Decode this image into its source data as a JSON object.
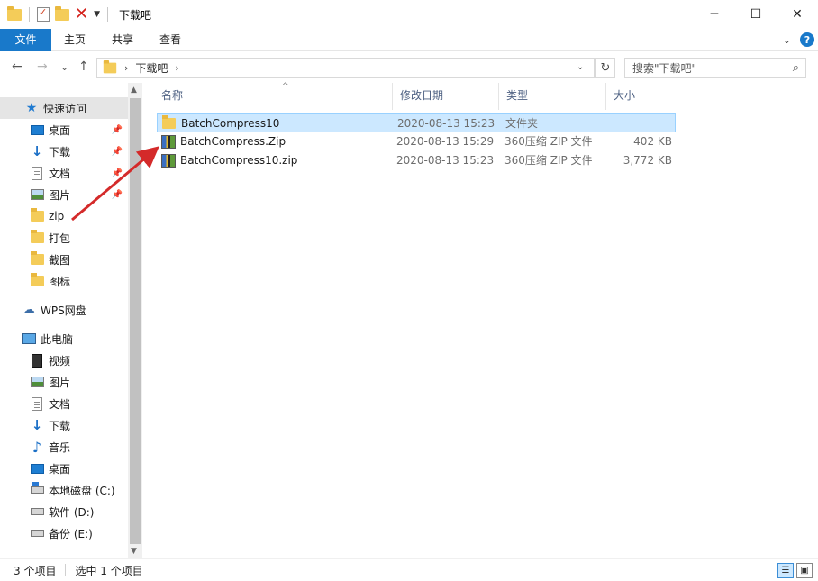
{
  "window": {
    "title": "下载吧",
    "minimize_label": "─",
    "maximize_label": "☐",
    "close_label": "✕"
  },
  "ribbon": {
    "tabs": [
      "文件",
      "主页",
      "共享",
      "查看"
    ]
  },
  "nav": {
    "back": "←",
    "forward": "→",
    "recent": "⌄",
    "up": "↑",
    "breadcrumb": [
      "下载吧"
    ],
    "refresh": "↻",
    "search_placeholder": "搜索\"下载吧\""
  },
  "sidebar": {
    "quick_access": {
      "label": "快速访问",
      "icon": "star-icon",
      "items": [
        {
          "label": "桌面",
          "icon": "desktop-icon",
          "pinned": true
        },
        {
          "label": "下载",
          "icon": "download-icon",
          "pinned": true
        },
        {
          "label": "文档",
          "icon": "document-icon",
          "pinned": true
        },
        {
          "label": "图片",
          "icon": "picture-icon",
          "pinned": true
        },
        {
          "label": "zip",
          "icon": "folder-icon",
          "pinned": false
        },
        {
          "label": "打包",
          "icon": "folder-icon",
          "pinned": false
        },
        {
          "label": "截图",
          "icon": "folder-icon",
          "pinned": false
        },
        {
          "label": "图标",
          "icon": "folder-icon",
          "pinned": false
        }
      ]
    },
    "wps": {
      "label": "WPS网盘",
      "icon": "cloud-icon"
    },
    "this_pc": {
      "label": "此电脑",
      "icon": "computer-icon",
      "items": [
        {
          "label": "视频",
          "icon": "video-icon"
        },
        {
          "label": "图片",
          "icon": "picture-icon"
        },
        {
          "label": "文档",
          "icon": "document-icon"
        },
        {
          "label": "下载",
          "icon": "download-icon"
        },
        {
          "label": "音乐",
          "icon": "music-icon"
        },
        {
          "label": "桌面",
          "icon": "desktop-icon"
        },
        {
          "label": "本地磁盘 (C:)",
          "icon": "system-drive-icon"
        },
        {
          "label": "软件 (D:)",
          "icon": "drive-icon"
        },
        {
          "label": "备份 (E:)",
          "icon": "drive-icon"
        }
      ]
    }
  },
  "columns": {
    "name": "名称",
    "date": "修改日期",
    "type": "类型",
    "size": "大小"
  },
  "files": [
    {
      "name": "BatchCompress10",
      "date": "2020-08-13 15:23",
      "type": "文件夹",
      "size": "",
      "icon": "folder-icon",
      "selected": true
    },
    {
      "name": "BatchCompress.Zip",
      "date": "2020-08-13 15:29",
      "type": "360压缩 ZIP 文件",
      "size": "402 KB",
      "icon": "zip-archive-icon",
      "selected": false
    },
    {
      "name": "BatchCompress10.zip",
      "date": "2020-08-13 15:23",
      "type": "360压缩 ZIP 文件",
      "size": "3,772 KB",
      "icon": "zip-archive-icon",
      "selected": false
    }
  ],
  "status": {
    "count": "3 个项目",
    "selected": "选中 1 个项目"
  },
  "colors": {
    "accent": "#1979ca",
    "selection": "#cce8ff",
    "annotation_arrow": "#d42a2a"
  }
}
